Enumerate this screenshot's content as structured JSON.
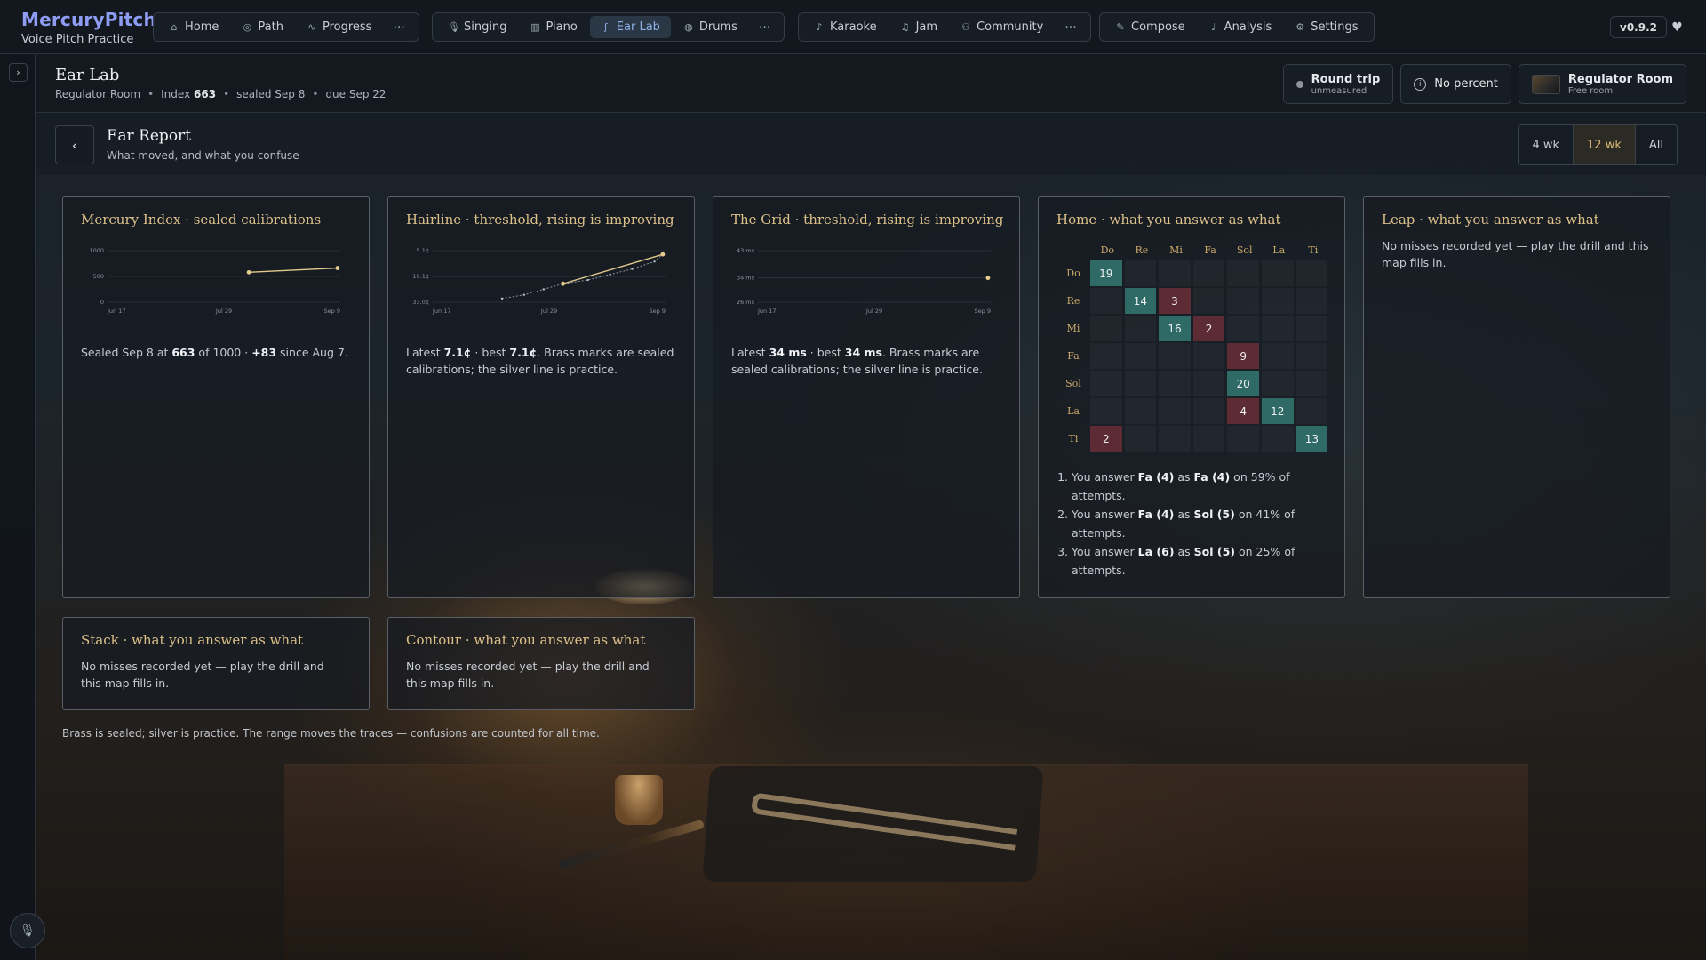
{
  "brand": {
    "name": "MercuryPitch",
    "subtitle": "Voice Pitch Practice"
  },
  "nav": {
    "group1": [
      {
        "label": "Home",
        "icon": "home-icon"
      },
      {
        "label": "Path",
        "icon": "compass-icon"
      },
      {
        "label": "Progress",
        "icon": "trend-icon"
      }
    ],
    "group2": [
      {
        "label": "Singing",
        "icon": "mic-icon"
      },
      {
        "label": "Piano",
        "icon": "piano-icon"
      },
      {
        "label": "Ear Lab",
        "icon": "ear-icon",
        "active": true
      },
      {
        "label": "Drums",
        "icon": "drum-icon"
      }
    ],
    "group3": [
      {
        "label": "Karaoke",
        "icon": "karaoke-icon"
      },
      {
        "label": "Jam",
        "icon": "music-note-icon"
      },
      {
        "label": "Community",
        "icon": "users-icon"
      }
    ],
    "group4": [
      {
        "label": "Compose",
        "icon": "pencil-icon"
      },
      {
        "label": "Analysis",
        "icon": "note-icon"
      },
      {
        "label": "Settings",
        "icon": "gear-icon"
      }
    ],
    "more": "···",
    "version": "v0.9.2"
  },
  "page": {
    "title": "Ear Lab",
    "room": "Regulator Room",
    "index_label": "Index",
    "index_value": "663",
    "sealed": "sealed Sep 8",
    "due": "due Sep 22",
    "round_trip_title": "Round trip",
    "round_trip_sub": "unmeasured",
    "no_percent": "No percent",
    "room_title": "Regulator Room",
    "room_sub": "Free room"
  },
  "report": {
    "title": "Ear Report",
    "subtitle": "What moved, and what you confuse",
    "ranges": [
      "4 wk",
      "12 wk",
      "All"
    ],
    "active_range": "12 wk"
  },
  "cards": {
    "mercury": {
      "title": "Mercury Index · sealed calibrations",
      "text_pre": "Sealed Sep 8 at ",
      "text_value": "663",
      "text_mid": " of 1000 · ",
      "text_delta": "+83",
      "text_post": " since Aug 7."
    },
    "hairline": {
      "title": "Hairline · threshold, rising is improving",
      "t1": "Latest ",
      "latest": "7.1¢",
      "t2": " · best ",
      "best": "7.1¢",
      "t3": ". Brass marks are sealed calibrations; the silver line is practice."
    },
    "grid": {
      "title": "The Grid · threshold, rising is improving",
      "t1": "Latest ",
      "latest": "34 ms",
      "t2": " · best ",
      "best": "34 ms",
      "t3": ". Brass marks are sealed calibrations; the silver line is practice."
    },
    "home": {
      "title": "Home · what you answer as what",
      "confusions": [
        {
          "a": "Fa (4)",
          "b": "Fa (4)",
          "pct": "59%"
        },
        {
          "a": "Fa (4)",
          "b": "Sol (5)",
          "pct": "41%"
        },
        {
          "a": "La (6)",
          "b": "Sol (5)",
          "pct": "25%"
        }
      ],
      "c_pre": "You answer ",
      "c_as": " as ",
      "c_on": " on ",
      "c_post": " of attempts."
    },
    "leap": {
      "title": "Leap · what you answer as what",
      "text": "No misses recorded yet — play the drill and this map fills in."
    },
    "stack": {
      "title": "Stack · what you answer as what",
      "text": "No misses recorded yet — play the drill and this map fills in."
    },
    "contour": {
      "title": "Contour · what you answer as what",
      "text": "No misses recorded yet — play the drill and this map fills in."
    }
  },
  "footnote": "Brass is sealed; silver is practice. The range moves the traces — confusions are counted for all time.",
  "colors": {
    "brand": "#8e9cf3",
    "brass": "#dcc089",
    "diag_cell": "#2f6a67",
    "miss_cell": "#5d2b33"
  },
  "chart_data": [
    {
      "type": "line",
      "title": "Mercury Index · sealed calibrations",
      "x_ticks": [
        "Jun 17",
        "Jul 29",
        "Sep 9"
      ],
      "y_ticks": [
        "0",
        "500",
        "1000"
      ],
      "ylim": [
        0,
        1000
      ],
      "series": [
        {
          "x": [
            "Aug 7",
            "Sep 8"
          ],
          "values": [
            580,
            663
          ]
        }
      ]
    },
    {
      "type": "line",
      "title": "Hairline · threshold, rising is improving",
      "x_ticks": [
        "Jun 17",
        "Jul 29",
        "Sep 9"
      ],
      "y_ticks": [
        "5.1¢",
        "19.1¢",
        "33.0¢"
      ],
      "series": [
        {
          "name": "practice",
          "x": [
            "Jul 12",
            "Jul 20",
            "Jul 27",
            "Aug 3",
            "Aug 12",
            "Aug 20",
            "Aug 28",
            "Sep 5",
            "Sep 8"
          ],
          "values": [
            31.0,
            29.0,
            26.0,
            23.0,
            21.0,
            18.0,
            15.0,
            11.0,
            7.1
          ]
        },
        {
          "name": "sealed",
          "x": [
            "Aug 3",
            "Sep 8"
          ],
          "values": [
            23.0,
            7.1
          ]
        }
      ]
    },
    {
      "type": "scatter",
      "title": "The Grid · threshold, rising is improving",
      "x_ticks": [
        "Jun 17",
        "Jul 29",
        "Sep 9"
      ],
      "y_ticks": [
        "26 ms",
        "34 ms",
        "43 ms"
      ],
      "series": [
        {
          "x": [
            "Sep 8"
          ],
          "values": [
            34
          ]
        }
      ]
    },
    {
      "type": "heatmap",
      "title": "Home · what you answer as what",
      "rows": [
        "Do",
        "Re",
        "Mi",
        "Fa",
        "Sol",
        "La",
        "Ti"
      ],
      "cols": [
        "Do",
        "Re",
        "Mi",
        "Fa",
        "Sol",
        "La",
        "Ti"
      ],
      "values": [
        [
          19,
          null,
          null,
          null,
          null,
          null,
          null
        ],
        [
          null,
          14,
          3,
          null,
          null,
          null,
          null
        ],
        [
          null,
          null,
          16,
          2,
          null,
          null,
          null
        ],
        [
          null,
          null,
          null,
          null,
          9,
          null,
          null
        ],
        [
          null,
          null,
          null,
          null,
          20,
          null,
          null
        ],
        [
          null,
          null,
          null,
          null,
          4,
          12,
          null
        ],
        [
          2,
          null,
          null,
          null,
          null,
          null,
          13
        ]
      ]
    }
  ]
}
